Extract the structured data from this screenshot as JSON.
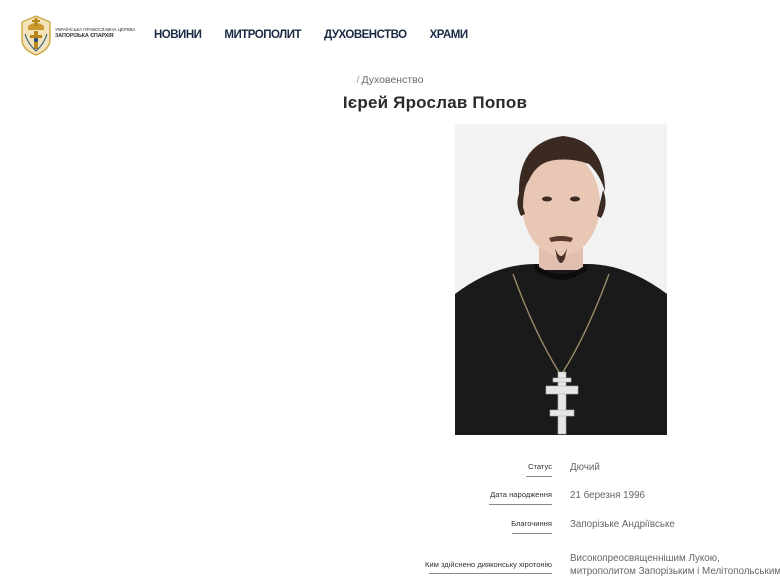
{
  "header": {
    "logo_line1": "УКРАЇНСЬКА ПРАВОСЛАВНА ЦЕРКВА",
    "logo_line2": "ЗАПОРІЗЬКА ЄПАРХІЯ",
    "nav": [
      {
        "label": "НОВИНИ"
      },
      {
        "label": "МИТРОПОЛИТ"
      },
      {
        "label": "ДУХОВЕНСТВО"
      },
      {
        "label": "ХРАМИ"
      }
    ]
  },
  "breadcrumb": {
    "separator": "/",
    "current": "Духовенство"
  },
  "page_title": "Ієрей Ярослав Попов",
  "info": {
    "status": {
      "label": "Статус",
      "value": "Дючий"
    },
    "birth": {
      "label": "Дата народження",
      "value": "21 березня 1996"
    },
    "deanery": {
      "label": "Благочиння",
      "value": "Запорізьке Андріївське"
    },
    "ordination": {
      "label": "Ким здійснено дияконську хіротонію",
      "value_line1": "Високопреосвященнішим Лукою,",
      "value_line2": "митрополитом Запорізьким і Мелітопольським"
    }
  },
  "colors": {
    "nav_text": "#1b2a44",
    "logo_gold": "#c89a2e",
    "cassock": "#1a1a1a",
    "background": "#ffffff"
  }
}
